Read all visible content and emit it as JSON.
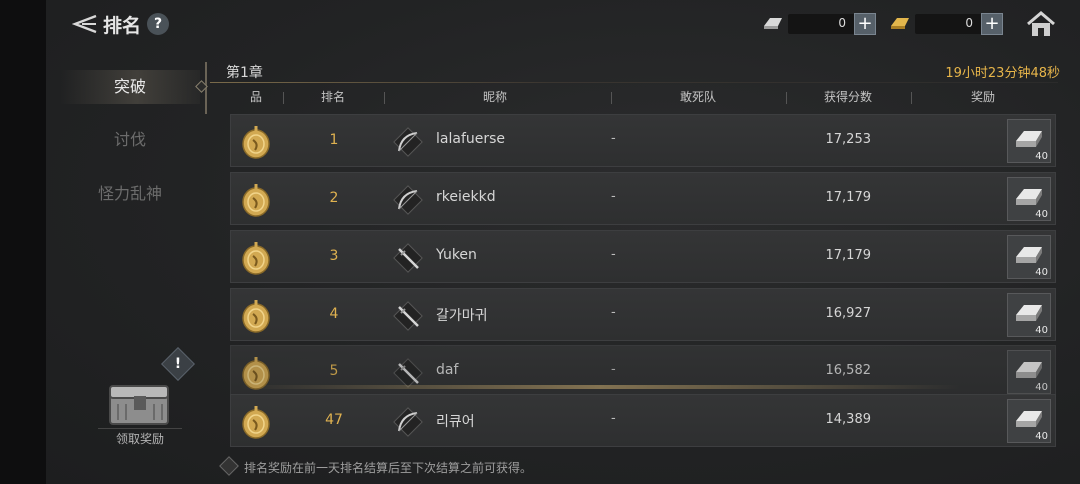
{
  "header": {
    "title": "排名",
    "help_icon": "?"
  },
  "currency": [
    {
      "name": "silver-ingot",
      "value": "0",
      "plus": "+"
    },
    {
      "name": "gold-ingot",
      "value": "0",
      "plus": "+"
    }
  ],
  "sidebar": {
    "items": [
      {
        "label": "突破",
        "active": true
      },
      {
        "label": "讨伐",
        "active": false
      },
      {
        "label": "怪力乱神",
        "active": false
      }
    ],
    "alert": "!",
    "claim_label": "领取奖励"
  },
  "main": {
    "chapter": "第1章",
    "timer": "19小时23分钟48秒",
    "columns": [
      "品",
      "排名",
      "昵称",
      "敢死队",
      "获得分数",
      "奖励"
    ],
    "rows": [
      {
        "rank": "1",
        "nickname": "lalafuerse",
        "team": "-",
        "score": "17,253",
        "class_icon": "bow-icon",
        "reward_count": "40"
      },
      {
        "rank": "2",
        "nickname": "rkeiekkd",
        "team": "-",
        "score": "17,179",
        "class_icon": "bow-icon",
        "reward_count": "40"
      },
      {
        "rank": "3",
        "nickname": "Yuken",
        "team": "-",
        "score": "17,179",
        "class_icon": "sword-icon",
        "reward_count": "40"
      },
      {
        "rank": "4",
        "nickname": "갈가마귀",
        "team": "-",
        "score": "16,927",
        "class_icon": "sword-icon",
        "reward_count": "40"
      },
      {
        "rank": "5",
        "nickname": "daf",
        "team": "-",
        "score": "16,582",
        "class_icon": "sword-icon",
        "reward_count": "40"
      },
      {
        "rank": "47",
        "nickname": "리큐어",
        "team": "-",
        "score": "14,389",
        "class_icon": "bow-icon",
        "reward_count": "40"
      }
    ],
    "note": "排名奖励在前一天排名结算后至下次结算之前可获得。"
  },
  "colors": {
    "accent_gold": "#e0b250",
    "timer": "#e7b54a"
  }
}
